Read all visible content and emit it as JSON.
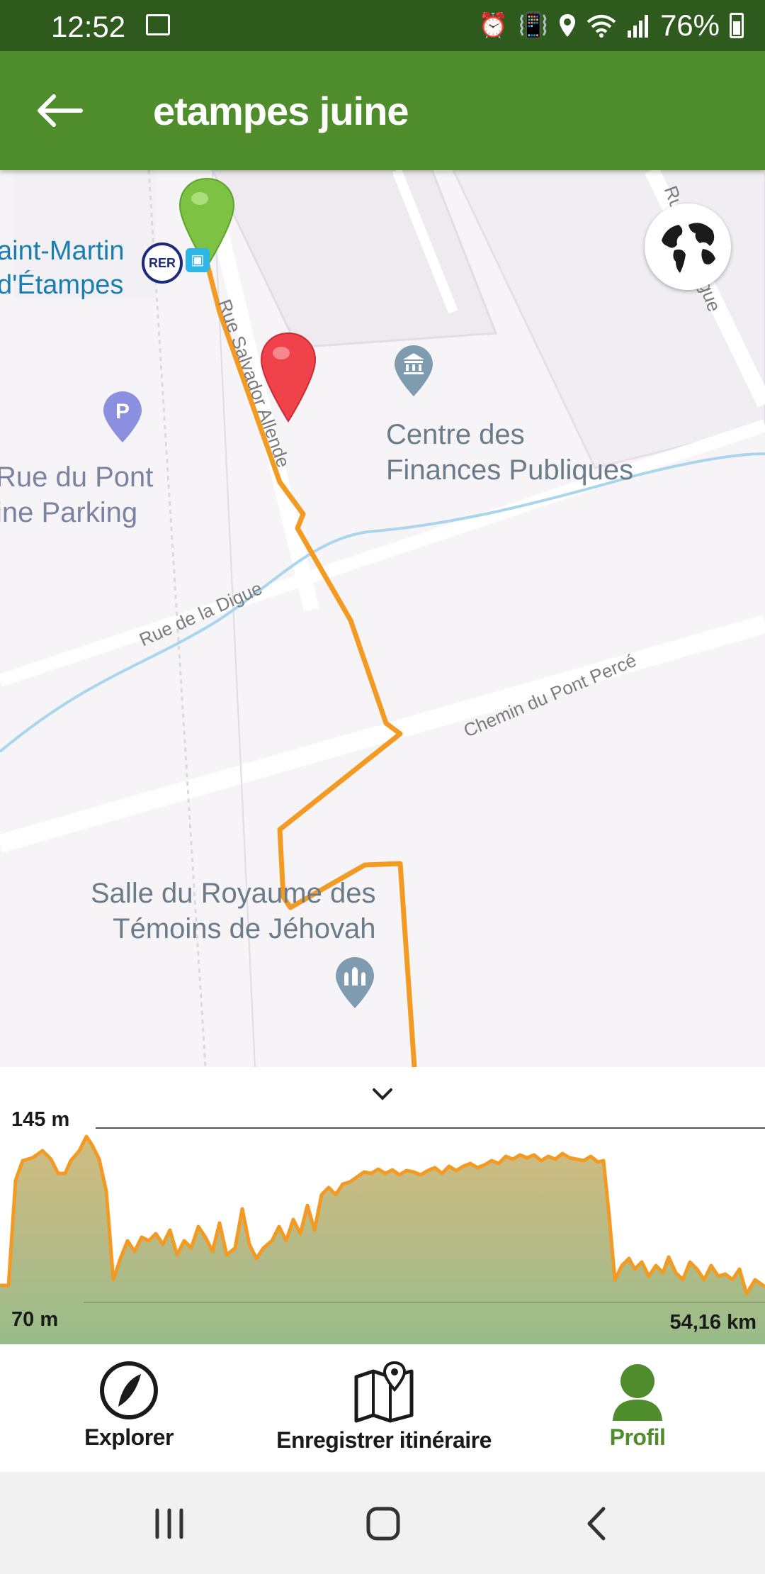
{
  "status_bar": {
    "time": "12:52",
    "battery": "76%",
    "icons": [
      "gallery-icon",
      "alarm-icon",
      "vibrate-icon",
      "location-icon",
      "wifi-icon",
      "signal-icon",
      "battery-icon"
    ]
  },
  "app_bar": {
    "title": "etampes juine",
    "back_icon": "arrow-left-icon",
    "background": "#4e8c2c"
  },
  "map": {
    "labels": {
      "station_line1": "aint-Martin",
      "station_line2": "d'Étampes",
      "parking_line1": "Rue du Pont",
      "parking_line2": "ine Parking",
      "finances_line1": "Centre des",
      "finances_line2": "Finances Publiques",
      "hall_line1": "Salle du Royaume des",
      "hall_line2": "Témoins de Jéhovah"
    },
    "streets": {
      "salvador": "Rue Salvador Allende",
      "digue": "Rue de la Digue",
      "digue_right": "Rue de la Digue",
      "pont_perce": "Chemin du Pont Percé"
    },
    "badges": {
      "rer": "RER"
    },
    "markers": {
      "start": {
        "color": "#7dc242",
        "icon": "start-pin-icon"
      },
      "current": {
        "color": "#f0424a",
        "icon": "position-pin-icon"
      }
    },
    "route_color": "#f39a23",
    "globe_icon": "globe-icon"
  },
  "elevation": {
    "max_label": "145 m",
    "min_label": "70 m",
    "distance_label": "54,16 km",
    "collapse_icon": "chevron-down-icon"
  },
  "bottom_nav": {
    "items": [
      {
        "label": "Explorer",
        "icon": "compass-icon",
        "active": false
      },
      {
        "label": "Enregistrer itinéraire",
        "icon": "map-pin-icon",
        "active": false
      },
      {
        "label": "Profil",
        "icon": "profile-icon",
        "active": true
      }
    ],
    "active_color": "#4e8c2c"
  },
  "system_nav": {
    "icons": [
      "recents-icon",
      "home-icon",
      "back-icon"
    ]
  }
}
